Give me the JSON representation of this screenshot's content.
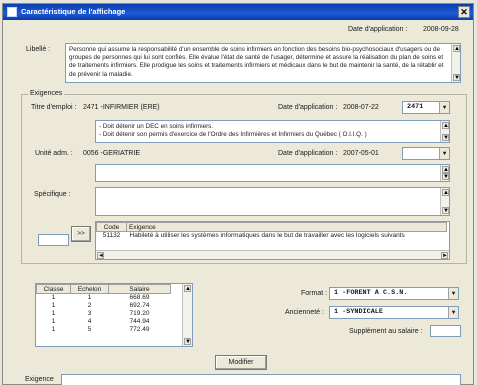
{
  "window": {
    "title": "Caractéristique de l'affichage",
    "close_glyph": "✕"
  },
  "header": {
    "date_label": "Date d'application :",
    "date_value": "2008-09-28"
  },
  "libelle": {
    "label": "Libellé :",
    "text": "Personne qui assume la responsabilité d'un ensemble de soins infirmiers en fonction des besoins bio-psychosociaux d'usagers ou de groupes de personnes qui lui sont confiés. Elle évalue l'état de santé de l'usager, détermine et assure la réalisation du plan de soins et de traitements infirmiers. Elle prodigue les soins et traitements infirmiers et médicaux dans le but de maintenir la santé, de la rétablir et de prévenir la maladie."
  },
  "exigences": {
    "group_title": "Exigences",
    "titre_emploi_label": "Titre d'emploi :",
    "titre_emploi_value": "2471 -INFIRMIER (ERE)",
    "date_app_label": "Date d'application :",
    "date_app_value": "2008-07-22",
    "combo_code": "2471",
    "requirements": [
      "- Doit détenir un DEC en soins infirmiers.",
      "- Doit détenir son permis d'exercice de l'Ordre des Infirmières et Infirmiers du Québec ( O.I.I.Q. )"
    ],
    "unite_label": "Unité adm. :",
    "unite_value": "0056 -GERIATRIE",
    "unite_date_label": "Date d'application :",
    "unite_date_value": "2007-05-01",
    "specifique_label": "Spécifique :",
    "transfer_glyph": ">>",
    "exigence_table": {
      "headers": [
        "Code",
        "Exigence"
      ],
      "rows": [
        {
          "code": "51132",
          "exigence": "Habileté à utiliser les systèmes informatiques dans le but de travailler avec les logiciels suivants"
        }
      ]
    }
  },
  "salary_table": {
    "headers": [
      "Classe",
      "Echelon",
      "Salaire"
    ],
    "rows": [
      {
        "classe": "1",
        "echelon": "1",
        "salaire": "668.69"
      },
      {
        "classe": "1",
        "echelon": "2",
        "salaire": "692.74"
      },
      {
        "classe": "1",
        "echelon": "3",
        "salaire": "719.20"
      },
      {
        "classe": "1",
        "echelon": "4",
        "salaire": "744.94"
      },
      {
        "classe": "1",
        "echelon": "5",
        "salaire": "772.49"
      }
    ]
  },
  "format": {
    "label": "Format :",
    "value": "1 -FORENT A C.S.N."
  },
  "anciennete": {
    "label": "Ancienneté :",
    "value": "1 -SYNDICALE"
  },
  "supplement": {
    "label": "Supplément au salaire :",
    "value": ""
  },
  "modifier_label": "Modifier",
  "footer": {
    "exigence_label": "Exigence"
  },
  "glyphs": {
    "up": "▲",
    "down": "▼",
    "left": "◄",
    "right": "►"
  },
  "colors": {
    "titlebar": "#0a3fb0",
    "window_bg": "#ece9d8",
    "field_border": "#7f9db9"
  }
}
